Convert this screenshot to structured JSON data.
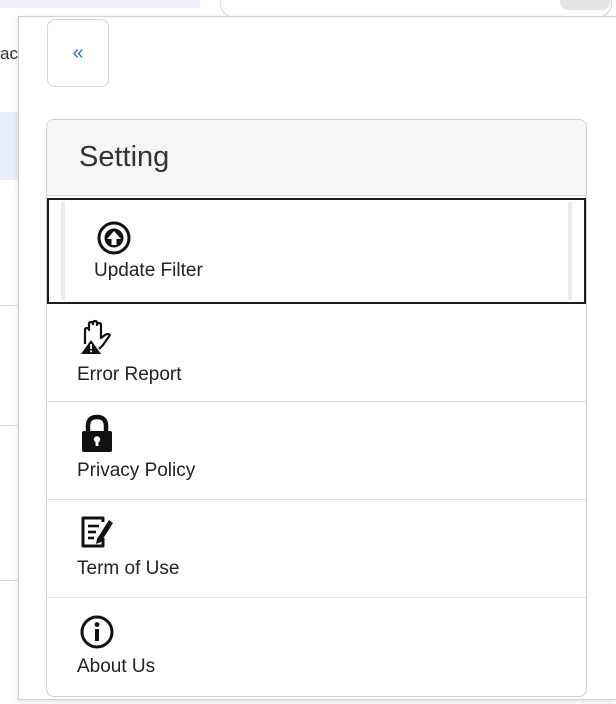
{
  "background": {
    "cut_text": "ac",
    "cut_mark": "/"
  },
  "panel": {
    "collapse_button_glyph": "«",
    "title": "Setting",
    "items": [
      {
        "label": "Update Filter",
        "icon": "upload-circle-icon",
        "active": true
      },
      {
        "label": "Error Report",
        "icon": "hand-warning-icon",
        "active": false
      },
      {
        "label": "Privacy Policy",
        "icon": "lock-icon",
        "active": false
      },
      {
        "label": "Term of Use",
        "icon": "document-edit-icon",
        "active": false
      },
      {
        "label": "About Us",
        "icon": "info-circle-icon",
        "active": false
      }
    ]
  },
  "colors": {
    "accent": "#2f6fd6",
    "active_border": "#1c1c1c"
  }
}
